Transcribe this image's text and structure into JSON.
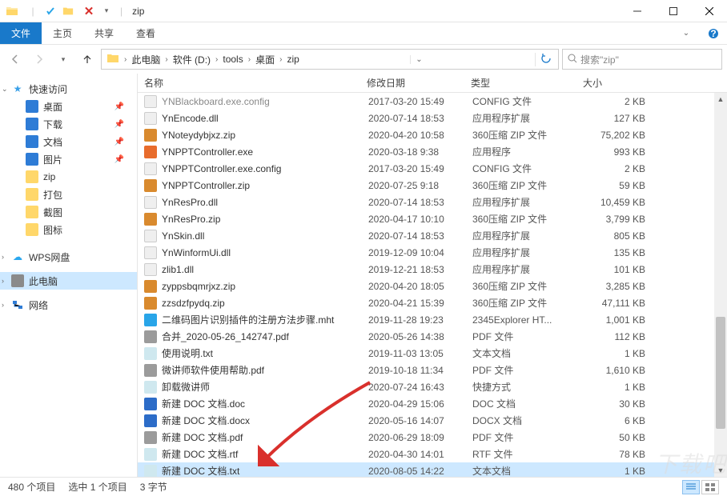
{
  "titlebar": {
    "title": "zip",
    "folder_sep": "|"
  },
  "ribbon": {
    "file": "文件",
    "tabs": [
      "主页",
      "共享",
      "查看"
    ]
  },
  "breadcrumb": {
    "items": [
      "此电脑",
      "软件 (D:)",
      "tools",
      "桌面",
      "zip"
    ]
  },
  "search": {
    "placeholder": "搜索\"zip\""
  },
  "sidebar": {
    "quick_access": "快速访问",
    "pinned": [
      {
        "label": "桌面",
        "icon": "ic-desktop"
      },
      {
        "label": "下载",
        "icon": "ic-dl"
      },
      {
        "label": "文档",
        "icon": "ic-doc"
      },
      {
        "label": "图片",
        "icon": "ic-pic"
      },
      {
        "label": "zip",
        "icon": "ic-folder"
      },
      {
        "label": "打包",
        "icon": "ic-folder"
      },
      {
        "label": "截图",
        "icon": "ic-folder"
      },
      {
        "label": "图标",
        "icon": "ic-folder"
      }
    ],
    "wps": "WPS网盘",
    "this_pc": "此电脑",
    "network": "网络"
  },
  "columns": {
    "name": "名称",
    "date": "修改日期",
    "type": "类型",
    "size": "大小"
  },
  "files": [
    {
      "icon": "fi-cfg",
      "name": "YNBlackboard.exe.config",
      "date": "2017-03-20 15:49",
      "type": "CONFIG 文件",
      "size": "2 KB",
      "dim": true
    },
    {
      "icon": "fi-dll",
      "name": "YnEncode.dll",
      "date": "2020-07-14 18:53",
      "type": "应用程序扩展",
      "size": "127 KB"
    },
    {
      "icon": "fi-zip",
      "name": "YNoteydybjxz.zip",
      "date": "2020-04-20 10:58",
      "type": "360压缩 ZIP 文件",
      "size": "75,202 KB"
    },
    {
      "icon": "fi-exe",
      "name": "YNPPTController.exe",
      "date": "2020-03-18 9:38",
      "type": "应用程序",
      "size": "993 KB"
    },
    {
      "icon": "fi-cfg",
      "name": "YNPPTController.exe.config",
      "date": "2017-03-20 15:49",
      "type": "CONFIG 文件",
      "size": "2 KB"
    },
    {
      "icon": "fi-zip",
      "name": "YNPPTController.zip",
      "date": "2020-07-25 9:18",
      "type": "360压缩 ZIP 文件",
      "size": "59 KB"
    },
    {
      "icon": "fi-dll",
      "name": "YnResPro.dll",
      "date": "2020-07-14 18:53",
      "type": "应用程序扩展",
      "size": "10,459 KB"
    },
    {
      "icon": "fi-zip",
      "name": "YnResPro.zip",
      "date": "2020-04-17 10:10",
      "type": "360压缩 ZIP 文件",
      "size": "3,799 KB"
    },
    {
      "icon": "fi-dll",
      "name": "YnSkin.dll",
      "date": "2020-07-14 18:53",
      "type": "应用程序扩展",
      "size": "805 KB"
    },
    {
      "icon": "fi-dll",
      "name": "YnWinformUi.dll",
      "date": "2019-12-09 10:04",
      "type": "应用程序扩展",
      "size": "135 KB"
    },
    {
      "icon": "fi-dll",
      "name": "zlib1.dll",
      "date": "2019-12-21 18:53",
      "type": "应用程序扩展",
      "size": "101 KB"
    },
    {
      "icon": "fi-zip",
      "name": "zyppsbqmrjxz.zip",
      "date": "2020-04-20 18:05",
      "type": "360压缩 ZIP 文件",
      "size": "3,285 KB"
    },
    {
      "icon": "fi-zip",
      "name": "zzsdzfpydq.zip",
      "date": "2020-04-21 15:39",
      "type": "360压缩 ZIP 文件",
      "size": "47,111 KB"
    },
    {
      "icon": "fi-mht",
      "name": "二维码图片识别插件的注册方法步骤.mht",
      "date": "2019-11-28 19:23",
      "type": "2345Explorer HT...",
      "size": "1,001 KB"
    },
    {
      "icon": "fi-pdf",
      "name": "合并_2020-05-26_142747.pdf",
      "date": "2020-05-26 14:38",
      "type": "PDF 文件",
      "size": "112 KB"
    },
    {
      "icon": "fi-txt",
      "name": "使用说明.txt",
      "date": "2019-11-03 13:05",
      "type": "文本文档",
      "size": "1 KB"
    },
    {
      "icon": "fi-pdf",
      "name": "微讲师软件使用帮助.pdf",
      "date": "2019-10-18 11:34",
      "type": "PDF 文件",
      "size": "1,610 KB"
    },
    {
      "icon": "fi-lnk",
      "name": "卸载微讲师",
      "date": "2020-07-24 16:43",
      "type": "快捷方式",
      "size": "1 KB"
    },
    {
      "icon": "fi-doc",
      "name": "新建 DOC 文档.doc",
      "date": "2020-04-29 15:06",
      "type": "DOC 文档",
      "size": "30 KB"
    },
    {
      "icon": "fi-doc",
      "name": "新建 DOC 文档.docx",
      "date": "2020-05-16 14:07",
      "type": "DOCX 文档",
      "size": "6 KB"
    },
    {
      "icon": "fi-pdf",
      "name": "新建 DOC 文档.pdf",
      "date": "2020-06-29 18:09",
      "type": "PDF 文件",
      "size": "50 KB"
    },
    {
      "icon": "fi-rtf",
      "name": "新建 DOC 文档.rtf",
      "date": "2020-04-30 14:01",
      "type": "RTF 文件",
      "size": "78 KB"
    },
    {
      "icon": "fi-txt",
      "name": "新建 DOC 文档.txt",
      "date": "2020-08-05 14:22",
      "type": "文本文档",
      "size": "1 KB",
      "selected": true
    }
  ],
  "status": {
    "count": "480 个项目",
    "selection": "选中 1 个项目",
    "bytes": "3 字节"
  },
  "watermark": "下载吧"
}
